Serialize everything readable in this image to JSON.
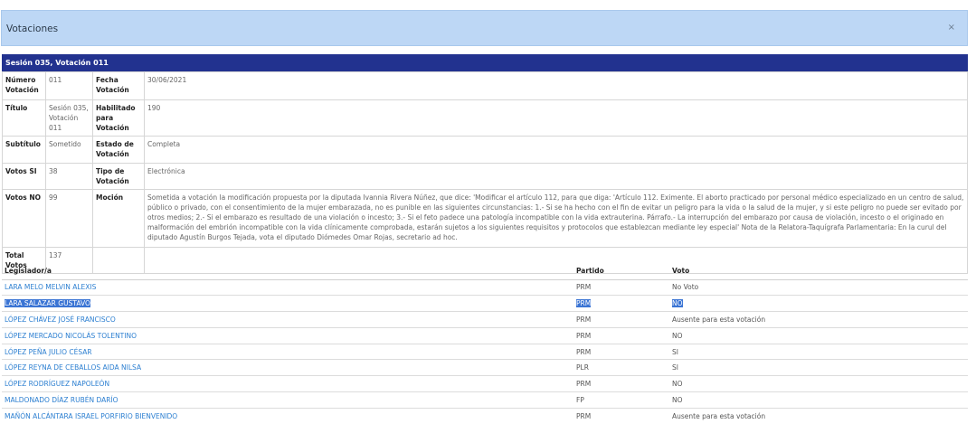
{
  "modal": {
    "title": "Votaciones",
    "close_label": "×"
  },
  "session": {
    "header": "Sesión 035, Votación 011"
  },
  "details": {
    "numero_label": "Número Votación",
    "numero_value": "011",
    "fecha_label": "Fecha Votación",
    "fecha_value": "30/06/2021",
    "titulo_label": "Título",
    "titulo_value": "Sesión 035, Votación 011",
    "habilitado_label": "Habilitado para Votación",
    "habilitado_value": "190",
    "subtitulo_label": "Subtítulo",
    "subtitulo_value": "Sometido",
    "estado_label": "Estado de Votación",
    "estado_value": "Completa",
    "votos_si_label": "Votos SI",
    "votos_si_value": "38",
    "tipo_label": "Tipo de Votación",
    "tipo_value": "Electrónica",
    "votos_no_label": "Votos NO",
    "votos_no_value": "99",
    "mocion_label": "Moción",
    "mocion_value": "Sometida a votación la modificación propuesta por la diputada Ivannia Rivera Núñez, que dice: 'Modificar el artículo 112, para que diga: 'Artículo 112. Eximente. El aborto practicado por personal médico especializado en un centro de salud, público o privado, con el consentimiento de la mujer embarazada, no es punible en las siguientes circunstancias: 1.- Si se ha hecho con el fin de evitar un peligro para la vida o la salud de la mujer, y si este peligro no puede ser evitado por otros medios; 2.- Si el embarazo es resultado de una violación o incesto; 3.- Si el feto padece una patología incompatible con la vida extrauterina. Párrafo.- La interrupción del embarazo por causa de violación, incesto o el originado en malformación del embrión incompatible con la vida clínicamente comprobada, estarán sujetos a los siguientes requisitos y protocolos que establezcan mediante ley especial' Nota de la Relatora-Taquígrafa Parlamentaria: En la curul del diputado Agustín Burgos Tejada, vota el diputado Diómedes Omar Rojas, secretario ad hoc.",
    "total_label": "Total Votos",
    "total_value": "137"
  },
  "legislators": {
    "headers": {
      "name": "Legislador/a",
      "party": "Partido",
      "vote": "Voto"
    },
    "rows": [
      {
        "name": "LARA MELO MELVIN ALEXIS",
        "party": "PRM",
        "vote": "No Voto"
      },
      {
        "name": "LARA SALAZAR GUSTAVO",
        "party": "PRM",
        "vote": "NO"
      },
      {
        "name": "LÓPEZ CHÁVEZ JOSÉ FRANCISCO",
        "party": "PRM",
        "vote": "Ausente para esta votación"
      },
      {
        "name": "LÓPEZ MERCADO NICOLÁS TOLENTINO",
        "party": "PRM",
        "vote": "NO"
      },
      {
        "name": "LÓPEZ PEÑA JULIO CÉSAR",
        "party": "PRM",
        "vote": "SI"
      },
      {
        "name": "LÓPEZ REYNA DE CEBALLOS AIDA NILSA",
        "party": "PLR",
        "vote": "SI"
      },
      {
        "name": "LÓPEZ RODRÍGUEZ NAPOLEÓN",
        "party": "PRM",
        "vote": "NO"
      },
      {
        "name": "MALDONADO DÍAZ RUBÉN DARÍO",
        "party": "FP",
        "vote": "NO"
      },
      {
        "name": "MAÑÓN ALCÁNTARA ISRAEL PORFIRIO BIENVENIDO",
        "party": "PRM",
        "vote": "Ausente para esta votación"
      }
    ]
  }
}
